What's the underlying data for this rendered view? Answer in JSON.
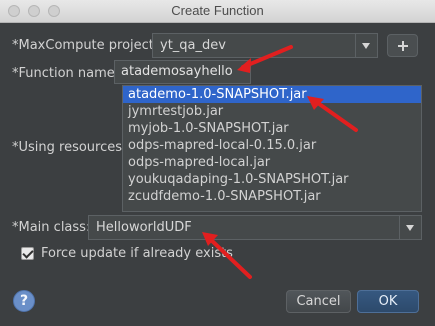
{
  "window": {
    "title": "Create Function"
  },
  "form": {
    "project_label": "*MaxCompute project:",
    "project_value": "yt_qa_dev",
    "function_label": "*Function name:",
    "function_value": "atademosayhello",
    "resources_label": "*Using resources:",
    "resources": [
      "atademo-1.0-SNAPSHOT.jar",
      "jymrtestjob.jar",
      "myjob-1.0-SNAPSHOT.jar",
      "odps-mapred-local-0.15.0.jar",
      "odps-mapred-local.jar",
      "youkuqadaping-1.0-SNAPSHOT.jar",
      "zcudfdemo-1.0-SNAPSHOT.jar"
    ],
    "selected_resource": "atademo-1.0-SNAPSHOT.jar",
    "main_class_label": "*Main class:",
    "main_class_value": "HelloworldUDF",
    "force_update_label": "Force update if already exists",
    "force_update_checked": true
  },
  "actions": {
    "help_label": "?",
    "cancel_label": "Cancel",
    "ok_label": "OK"
  },
  "colors": {
    "background": "#3c3f41",
    "selection": "#2f65ca",
    "annotation_arrow": "#e11f1f"
  },
  "icons": {
    "close": "close-icon",
    "minimize": "minimize-icon",
    "maximize": "maximize-icon",
    "dropdown": "chevron-down-icon",
    "add": "plus-icon",
    "check": "checkmark-icon",
    "help": "question-icon"
  }
}
